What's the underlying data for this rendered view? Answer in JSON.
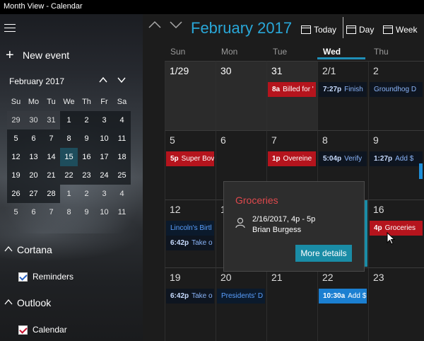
{
  "window": {
    "title": "Month View - Calendar",
    "controls": [
      "—",
      "☐",
      "✕"
    ]
  },
  "sidebar": {
    "new_event_label": "New event",
    "mini_calendar": {
      "title": "February 2017",
      "days_of_week": [
        "Su",
        "Mo",
        "Tu",
        "We",
        "Th",
        "Fr",
        "Sa"
      ],
      "weeks": [
        [
          "29",
          "30",
          "31",
          "1",
          "2",
          "3",
          "4"
        ],
        [
          "5",
          "6",
          "7",
          "8",
          "9",
          "10",
          "11"
        ],
        [
          "12",
          "13",
          "14",
          "15",
          "16",
          "17",
          "18"
        ],
        [
          "19",
          "20",
          "21",
          "22",
          "23",
          "24",
          "25"
        ],
        [
          "26",
          "27",
          "28",
          "1",
          "2",
          "3",
          "4"
        ],
        [
          "5",
          "6",
          "7",
          "8",
          "9",
          "10",
          "11"
        ]
      ]
    },
    "groups": [
      {
        "label": "Cortana",
        "items": [
          {
            "label": "Reminders",
            "checked": true,
            "color": "#2a64c5"
          }
        ]
      },
      {
        "label": "Outlook",
        "items": [
          {
            "label": "Calendar",
            "checked": true,
            "color": "#c8102e"
          }
        ]
      }
    ]
  },
  "toolbar": {
    "month_title": "February 2017",
    "today_label": "Today",
    "day_label": "Day",
    "week_label": "Week"
  },
  "calendar": {
    "days_of_week": [
      "Sun",
      "Mon",
      "Tue",
      "Wed",
      "Thu"
    ],
    "active_day": "Wed",
    "rows": [
      {
        "days": [
          "1/29",
          "30",
          "31",
          "2/1",
          "2"
        ],
        "events": [
          {
            "day": 2,
            "time": "8a",
            "title": "Billed for '",
            "style": "red",
            "slot": 0
          },
          {
            "day": 3,
            "time": "7:27p",
            "title": "Finish",
            "style": "dark",
            "slot": 0
          },
          {
            "day": 4,
            "time": "",
            "title": "Groundhog D",
            "style": "dark",
            "slot": 0
          }
        ]
      },
      {
        "days": [
          "5",
          "6",
          "7",
          "8",
          "9"
        ],
        "events": [
          {
            "day": 0,
            "time": "5p",
            "title": "Super Bov",
            "style": "red",
            "slot": 0
          },
          {
            "day": 2,
            "time": "1p",
            "title": "Overeine",
            "style": "red",
            "slot": 0
          },
          {
            "day": 3,
            "time": "5:04p",
            "title": "Verify",
            "style": "dark",
            "slot": 0
          },
          {
            "day": 4,
            "time": "1:27p",
            "title": "Add $",
            "style": "dark",
            "slot": 0
          }
        ]
      },
      {
        "days": [
          "12",
          "13",
          "14",
          "15",
          "16"
        ],
        "events": [
          {
            "day": 0,
            "time": "",
            "title": "Lincoln's Birtl",
            "style": "navy",
            "slot": 0
          },
          {
            "day": 0,
            "time": "6:42p",
            "title": "Take o",
            "style": "dark",
            "slot": 1
          },
          {
            "day": 4,
            "time": "4p",
            "title": "Groceries",
            "style": "red",
            "slot": 0
          }
        ]
      },
      {
        "days": [
          "19",
          "20",
          "21",
          "22",
          "23"
        ],
        "events": [
          {
            "day": 0,
            "time": "6:42p",
            "title": "Take o",
            "style": "dark",
            "slot": 0
          },
          {
            "day": 1,
            "time": "",
            "title": "Presidents' D",
            "style": "navy",
            "slot": 0
          },
          {
            "day": 3,
            "time": "10:30a",
            "title": "Add $",
            "style": "blue",
            "slot": 0
          }
        ]
      }
    ]
  },
  "popup": {
    "title": "Groceries",
    "datetime": "2/16/2017, 4p - 5p",
    "person": "Brian Burgess",
    "button_label": "More details"
  },
  "colors": {
    "accent": "#29a7d8",
    "red_event": "#b5141d",
    "popup_button": "#1a8ca6",
    "popup_title": "#e0494d"
  }
}
